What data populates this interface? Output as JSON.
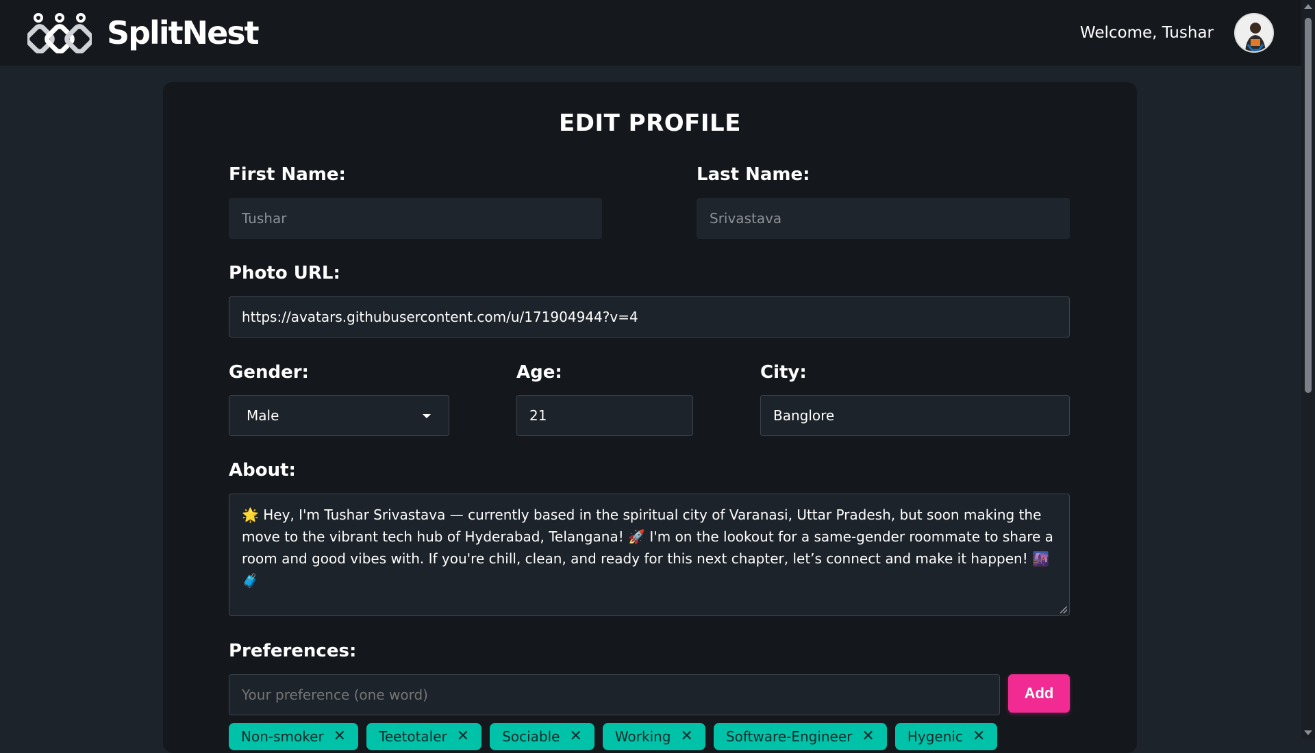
{
  "header": {
    "brand": "SplitNest",
    "welcome": "Welcome, Tushar"
  },
  "form": {
    "title": "EDIT PROFILE",
    "first_name_label": "First Name:",
    "first_name_value": "Tushar",
    "last_name_label": "Last Name:",
    "last_name_value": "Srivastava",
    "photo_label": "Photo URL:",
    "photo_value": "https://avatars.githubusercontent.com/u/171904944?v=4",
    "gender_label": "Gender:",
    "gender_value": "Male",
    "age_label": "Age:",
    "age_value": "21",
    "city_label": "City:",
    "city_value": "Banglore",
    "about_label": "About:",
    "about_value": "🌟 Hey, I'm Tushar Srivastava — currently based in the spiritual city of Varanasi, Uttar Pradesh, but soon making the move to the vibrant tech hub of Hyderabad, Telangana! 🚀 I'm on the lookout for a same-gender roommate to share a room and good vibes with. If you're chill, clean, and ready for this next chapter, let’s connect and make it happen! 🌆 🧳",
    "preferences_label": "Preferences:",
    "preference_placeholder": "Your preference (one word)",
    "add_label": "Add",
    "tags": [
      "Non-smoker",
      "Teetotaler",
      "Sociable",
      "Working",
      "Software-Engineer",
      "Hygenic"
    ]
  },
  "colors": {
    "accent_pink": "#f22b93",
    "tag_teal": "#00c2a8",
    "page_bg": "#1d232a",
    "card_bg": "#14181d"
  },
  "icons": [
    "logo-icon",
    "avatar",
    "chevron-down-icon",
    "close-icon",
    "resize-grip"
  ]
}
